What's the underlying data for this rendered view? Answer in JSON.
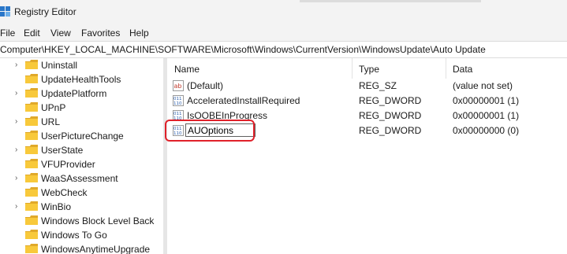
{
  "window": {
    "title": "Registry Editor"
  },
  "menu": [
    "File",
    "Edit",
    "View",
    "Favorites",
    "Help"
  ],
  "address": "Computer\\HKEY_LOCAL_MACHINE\\SOFTWARE\\Microsoft\\Windows\\CurrentVersion\\WindowsUpdate\\Auto Update",
  "tree": {
    "items": [
      {
        "label": "Uninstall",
        "expandable": true
      },
      {
        "label": "UpdateHealthTools",
        "expandable": false
      },
      {
        "label": "UpdatePlatform",
        "expandable": true
      },
      {
        "label": "UPnP",
        "expandable": false
      },
      {
        "label": "URL",
        "expandable": true
      },
      {
        "label": "UserPictureChange",
        "expandable": false
      },
      {
        "label": "UserState",
        "expandable": true
      },
      {
        "label": "VFUProvider",
        "expandable": false
      },
      {
        "label": "WaaSAssessment",
        "expandable": true
      },
      {
        "label": "WebCheck",
        "expandable": false
      },
      {
        "label": "WinBio",
        "expandable": true
      },
      {
        "label": "Windows Block Level Back",
        "expandable": false
      },
      {
        "label": "Windows To Go",
        "expandable": false
      },
      {
        "label": "WindowsAnytimeUpgrade",
        "expandable": false
      }
    ]
  },
  "values_pane": {
    "headers": {
      "name": "Name",
      "type": "Type",
      "data": "Data"
    },
    "rows": [
      {
        "name": "(Default)",
        "type": "REG_SZ",
        "data": "(value not set)",
        "icon": "string-value-icon"
      },
      {
        "name": "AcceleratedInstallRequired",
        "type": "REG_DWORD",
        "data": "0x00000001 (1)",
        "icon": "binary-value-icon"
      },
      {
        "name": "IsOOBEInProgress",
        "type": "REG_DWORD",
        "data": "0x00000001 (1)",
        "icon": "binary-value-icon"
      },
      {
        "name": "",
        "type": "REG_DWORD",
        "data": "0x00000000 (0)",
        "icon": "binary-value-icon"
      }
    ],
    "rename_value": "AUOptions"
  },
  "colors": {
    "highlight": "#e0212a",
    "folder": "#f8c93b",
    "folder_dark": "#e0a92a"
  }
}
